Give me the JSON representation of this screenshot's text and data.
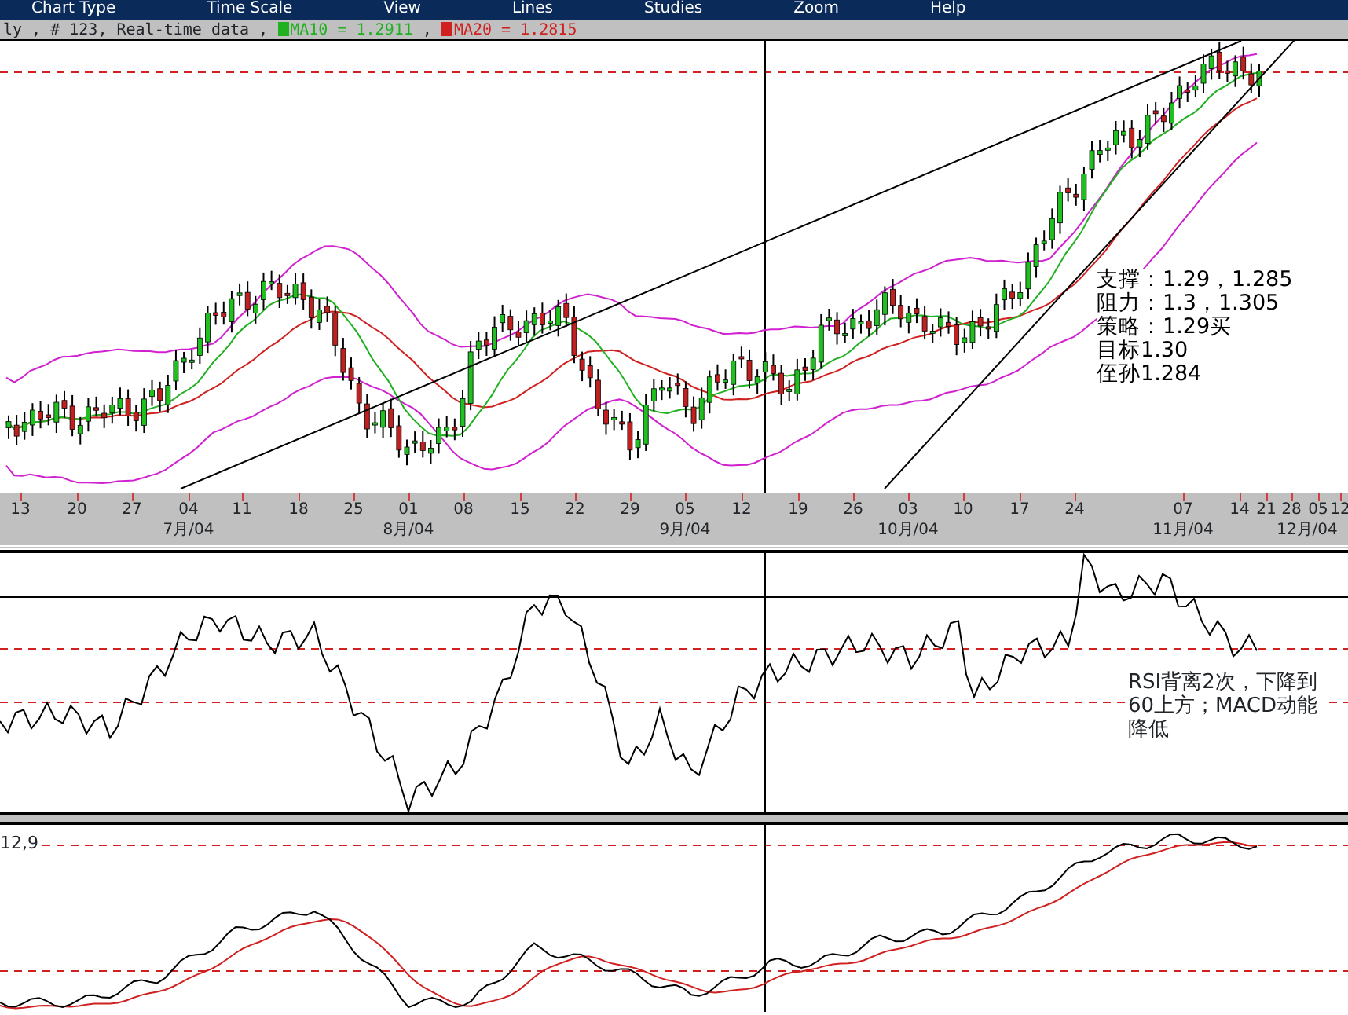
{
  "menu": [
    {
      "label": "Chart Type"
    },
    {
      "label": "Time Scale"
    },
    {
      "label": "View"
    },
    {
      "label": "Lines"
    },
    {
      "label": "Studies"
    },
    {
      "label": "Zoom"
    },
    {
      "label": "Help"
    }
  ],
  "legend": {
    "info": "ly , # 123, Real-time data ,",
    "separator": ",",
    "indicators": [
      {
        "label": "MA10 = 1.2911",
        "color": "#20b020"
      },
      {
        "label": "MA20 = 1.2815",
        "color": "#d02020"
      }
    ]
  },
  "price_panel": {
    "notes": [
      "支撑：1.29，1.285",
      "阻力：1.3，1.305",
      "策略：1.29买",
      "目标1.30",
      "侄孙1.284"
    ]
  },
  "time_axis": {
    "days": [
      {
        "label": "13"
      },
      {
        "label": "20"
      },
      {
        "label": "27"
      },
      {
        "label": "04",
        "month": "7月/04"
      },
      {
        "label": "11"
      },
      {
        "label": "18"
      },
      {
        "label": "25"
      },
      {
        "label": "01",
        "month": "8月/04"
      },
      {
        "label": "08"
      },
      {
        "label": "15"
      },
      {
        "label": "22"
      },
      {
        "label": "29"
      },
      {
        "label": "05",
        "month": "9月/04"
      },
      {
        "label": "12"
      },
      {
        "label": "19"
      },
      {
        "label": "26"
      },
      {
        "label": "03",
        "month": "10月/04"
      },
      {
        "label": "10"
      },
      {
        "label": "17"
      },
      {
        "label": "24"
      },
      {
        "label": "07",
        "month": "11月/04"
      },
      {
        "label": "14"
      },
      {
        "label": "21"
      },
      {
        "label": "28"
      },
      {
        "label": "05",
        "month": "12月/04"
      },
      {
        "label": "12"
      }
    ]
  },
  "rsi_panel": {
    "note": "RSI背离2次，下降到60上方；MACD动能降低"
  },
  "macd_panel": {
    "label": "12,9"
  }
}
